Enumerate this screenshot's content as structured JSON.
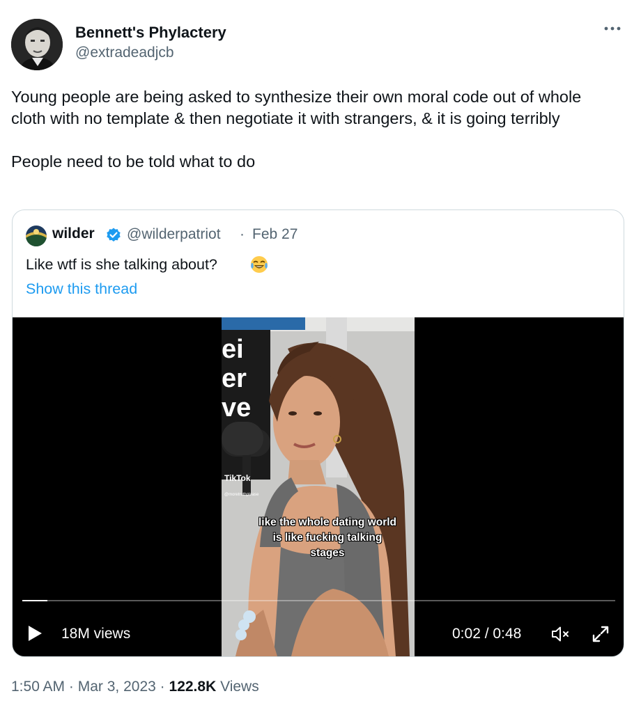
{
  "author": {
    "name": "Bennett's Phylactery",
    "handle": "@extradeadjcb"
  },
  "more_icon": "more-horizontal-icon",
  "tweet": {
    "paragraphs": [
      "Young people are being asked to synthesize their own moral code out of whole cloth with no template & then negotiate it with strangers, & it is going terribly",
      "People need to be told what to do"
    ]
  },
  "quoted": {
    "name": "wilder",
    "handle": "@wilderpatriot",
    "separator": "·",
    "date": "Feb 27",
    "text": "Like wtf is she talking about?",
    "emoji": "face-with-tears-of-joy-emoji",
    "show_thread": "Show this thread",
    "verified_color": "#1d9bf0",
    "video": {
      "watermark": "TikTok",
      "watermark_user": "@moretruthplease",
      "caption": "like the whole dating world is like fucking talking stages",
      "views": "18M views",
      "time": "0:02 / 0:48",
      "progress": 0.042
    }
  },
  "meta": {
    "time": "1:50 AM",
    "sep1": "·",
    "date": "Mar 3, 2023",
    "sep2": "·",
    "views_count": "122.8K",
    "views_label": "Views"
  },
  "colors": {
    "text": "#0f1419",
    "secondary": "#536471",
    "link": "#1d9bf0",
    "border": "#cfd9de"
  }
}
